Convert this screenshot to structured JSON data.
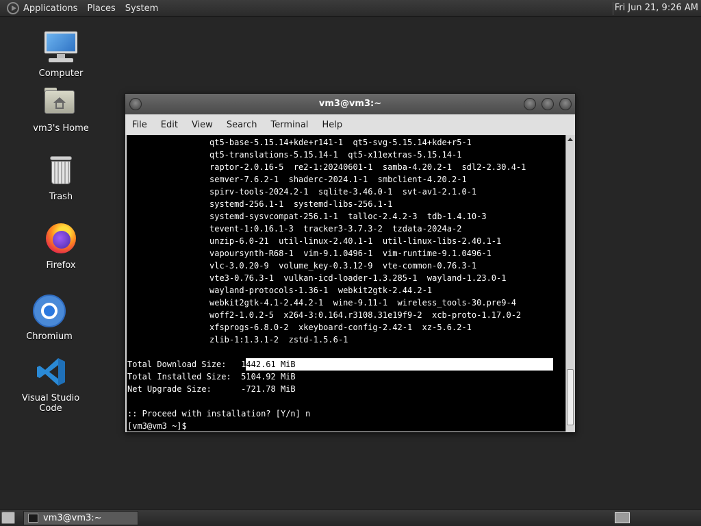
{
  "top_panel": {
    "menus": [
      "Applications",
      "Places",
      "System"
    ],
    "clock": "Fri Jun 21,  9:26 AM"
  },
  "desktop": {
    "icons": [
      {
        "label": "Computer",
        "icon": "computer-icon"
      },
      {
        "label": "vm3's Home",
        "icon": "home-folder-icon"
      },
      {
        "label": "Trash",
        "icon": "trash-icon"
      },
      {
        "label": "Firefox",
        "icon": "firefox-icon"
      },
      {
        "label": "Chromium",
        "icon": "chromium-icon"
      },
      {
        "label": "Visual Studio Code",
        "icon": "vscode-icon"
      }
    ]
  },
  "terminal": {
    "title": "vm3@vm3:~",
    "menus": [
      "File",
      "Edit",
      "View",
      "Search",
      "Terminal",
      "Help"
    ],
    "package_lines": [
      "qt5-base-5.15.14+kde+r141-1  qt5-svg-5.15.14+kde+r5-1",
      "qt5-translations-5.15.14-1  qt5-x11extras-5.15.14-1",
      "raptor-2.0.16-5  re2-1:20240601-1  samba-4.20.2-1  sdl2-2.30.4-1",
      "semver-7.6.2-1  shaderc-2024.1-1  smbclient-4.20.2-1",
      "spirv-tools-2024.2-1  sqlite-3.46.0-1  svt-av1-2.1.0-1",
      "systemd-256.1-1  systemd-libs-256.1-1",
      "systemd-sysvcompat-256.1-1  talloc-2.4.2-3  tdb-1.4.10-3",
      "tevent-1:0.16.1-3  tracker3-3.7.3-2  tzdata-2024a-2",
      "unzip-6.0-21  util-linux-2.40.1-1  util-linux-libs-2.40.1-1",
      "vapoursynth-R68-1  vim-9.1.0496-1  vim-runtime-9.1.0496-1",
      "vlc-3.0.20-9  volume_key-0.3.12-9  vte-common-0.76.3-1",
      "vte3-0.76.3-1  vulkan-icd-loader-1.3.285-1  wayland-1.23.0-1",
      "wayland-protocols-1.36-1  webkit2gtk-2.44.2-1",
      "webkit2gtk-4.1-2.44.2-1  wine-9.11-1  wireless_tools-30.pre9-4",
      "woff2-1.0.2-5  x264-3:0.164.r3108.31e19f9-2  xcb-proto-1.17.0-2",
      "xfsprogs-6.8.0-2  xkeyboard-config-2.42-1  xz-5.6.2-1",
      "zlib-1:1.3.1-2  zstd-1.5.6-1"
    ],
    "download_size_label": "Total Download Size:   1",
    "download_size_value": "442.61 MiB",
    "installed_size_line": "Total Installed Size:  5104.92 MiB",
    "net_upgrade_line": "Net Upgrade Size:      -721.78 MiB",
    "proceed_prompt": ":: Proceed with installation? [Y/n] n",
    "shell_prompt": "[vm3@vm3 ~]$"
  },
  "taskbar": {
    "window_button_label": "vm3@vm3:~"
  }
}
